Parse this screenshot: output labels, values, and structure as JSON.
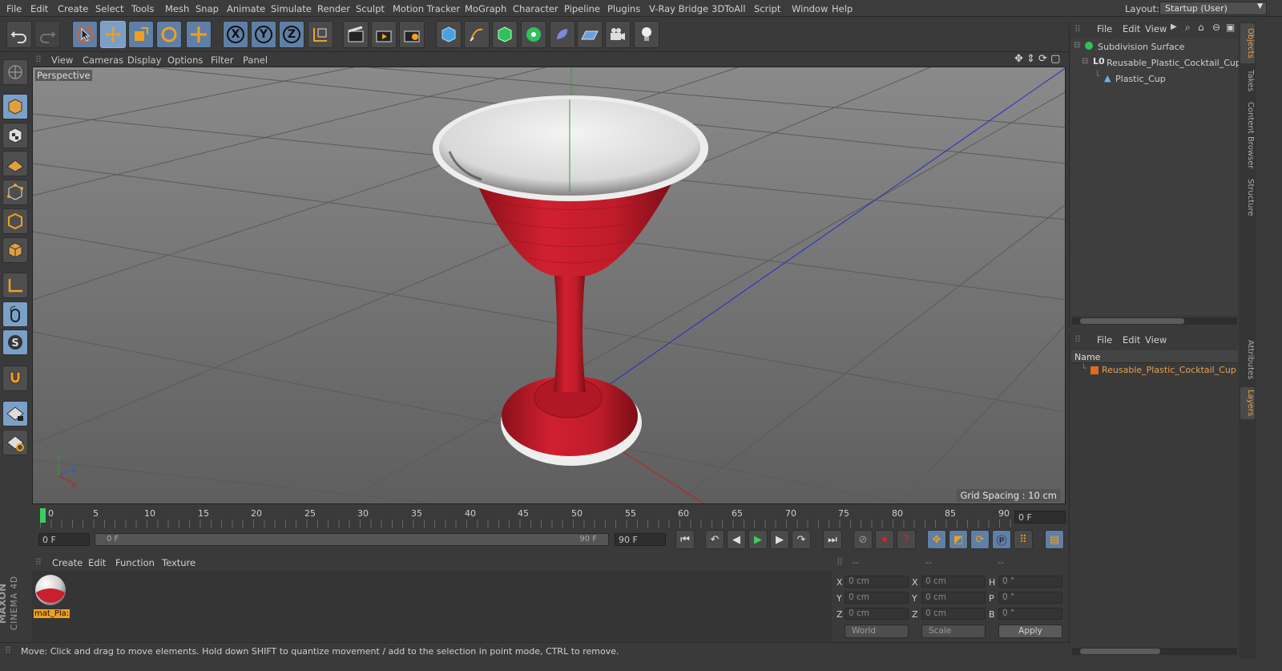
{
  "menubar": {
    "items": [
      "File",
      "Edit",
      "Create",
      "Select",
      "Tools",
      "Mesh",
      "Snap",
      "Animate",
      "Simulate",
      "Render",
      "Sculpt",
      "Motion Tracker",
      "MoGraph",
      "Character",
      "Pipeline",
      "Plugins",
      "V-Ray Bridge",
      "3DToAll",
      "Script",
      "Window",
      "Help"
    ],
    "layout_label": "Layout:",
    "layout_value": "Startup (User)"
  },
  "toolbar": {
    "axis_x": "X",
    "axis_y": "Y",
    "axis_z": "Z"
  },
  "viewport": {
    "menu": [
      "View",
      "Cameras",
      "Display",
      "Options",
      "Filter",
      "Panel"
    ],
    "camera_label": "Perspective",
    "grid_spacing": "Grid Spacing : 10 cm",
    "axis_y": "Y",
    "axis_z": "Z",
    "axis_x": "X"
  },
  "timeline": {
    "ticks": [
      "0",
      "5",
      "10",
      "15",
      "20",
      "25",
      "30",
      "35",
      "40",
      "45",
      "50",
      "55",
      "60",
      "65",
      "70",
      "75",
      "80",
      "85",
      "90"
    ],
    "current_frame": "0 F",
    "start_field": "0 F",
    "range_start": "0 F",
    "range_end": "90 F",
    "end_field": "90 F"
  },
  "material_manager": {
    "menu": [
      "Create",
      "Edit",
      "Function",
      "Texture"
    ],
    "material_name": "mat_Pla:"
  },
  "coordinates": {
    "header": [
      "--",
      "--",
      "--"
    ],
    "rows": [
      {
        "a": "X",
        "av": "0 cm",
        "b": "X",
        "bv": "0 cm",
        "c": "H",
        "cv": "0 °"
      },
      {
        "a": "Y",
        "av": "0 cm",
        "b": "Y",
        "bv": "0 cm",
        "c": "P",
        "cv": "0 °"
      },
      {
        "a": "Z",
        "av": "0 cm",
        "b": "Z",
        "bv": "0 cm",
        "c": "B",
        "cv": "0 °"
      }
    ],
    "mode_world": "World",
    "mode_scale": "Scale",
    "apply": "Apply"
  },
  "status": {
    "text": "Move: Click and drag to move elements. Hold down SHIFT to quantize movement / add to the selection in point mode, CTRL to remove."
  },
  "objects_panel": {
    "menu": [
      "File",
      "Edit",
      "View"
    ],
    "items": [
      "Subdivision Surface",
      "Reusable_Plastic_Cocktail_Cup",
      "Plastic_Cup"
    ]
  },
  "layers_panel": {
    "menu": [
      "File",
      "Edit",
      "View"
    ],
    "column_name": "Name",
    "layer": "Reusable_Plastic_Cocktail_Cup"
  },
  "right_tabs": [
    "Objects",
    "Takes",
    "Content Browser",
    "Structure",
    "Attributes",
    "Layers"
  ],
  "brand": {
    "maxon": "MAXON",
    "c4d": "CINEMA 4D"
  },
  "colors": {
    "accent": "#e8a050",
    "cup_red": "#c8202e",
    "viewport_bg": "#6e6e6e",
    "selected_tool": "#7aa0c8"
  }
}
